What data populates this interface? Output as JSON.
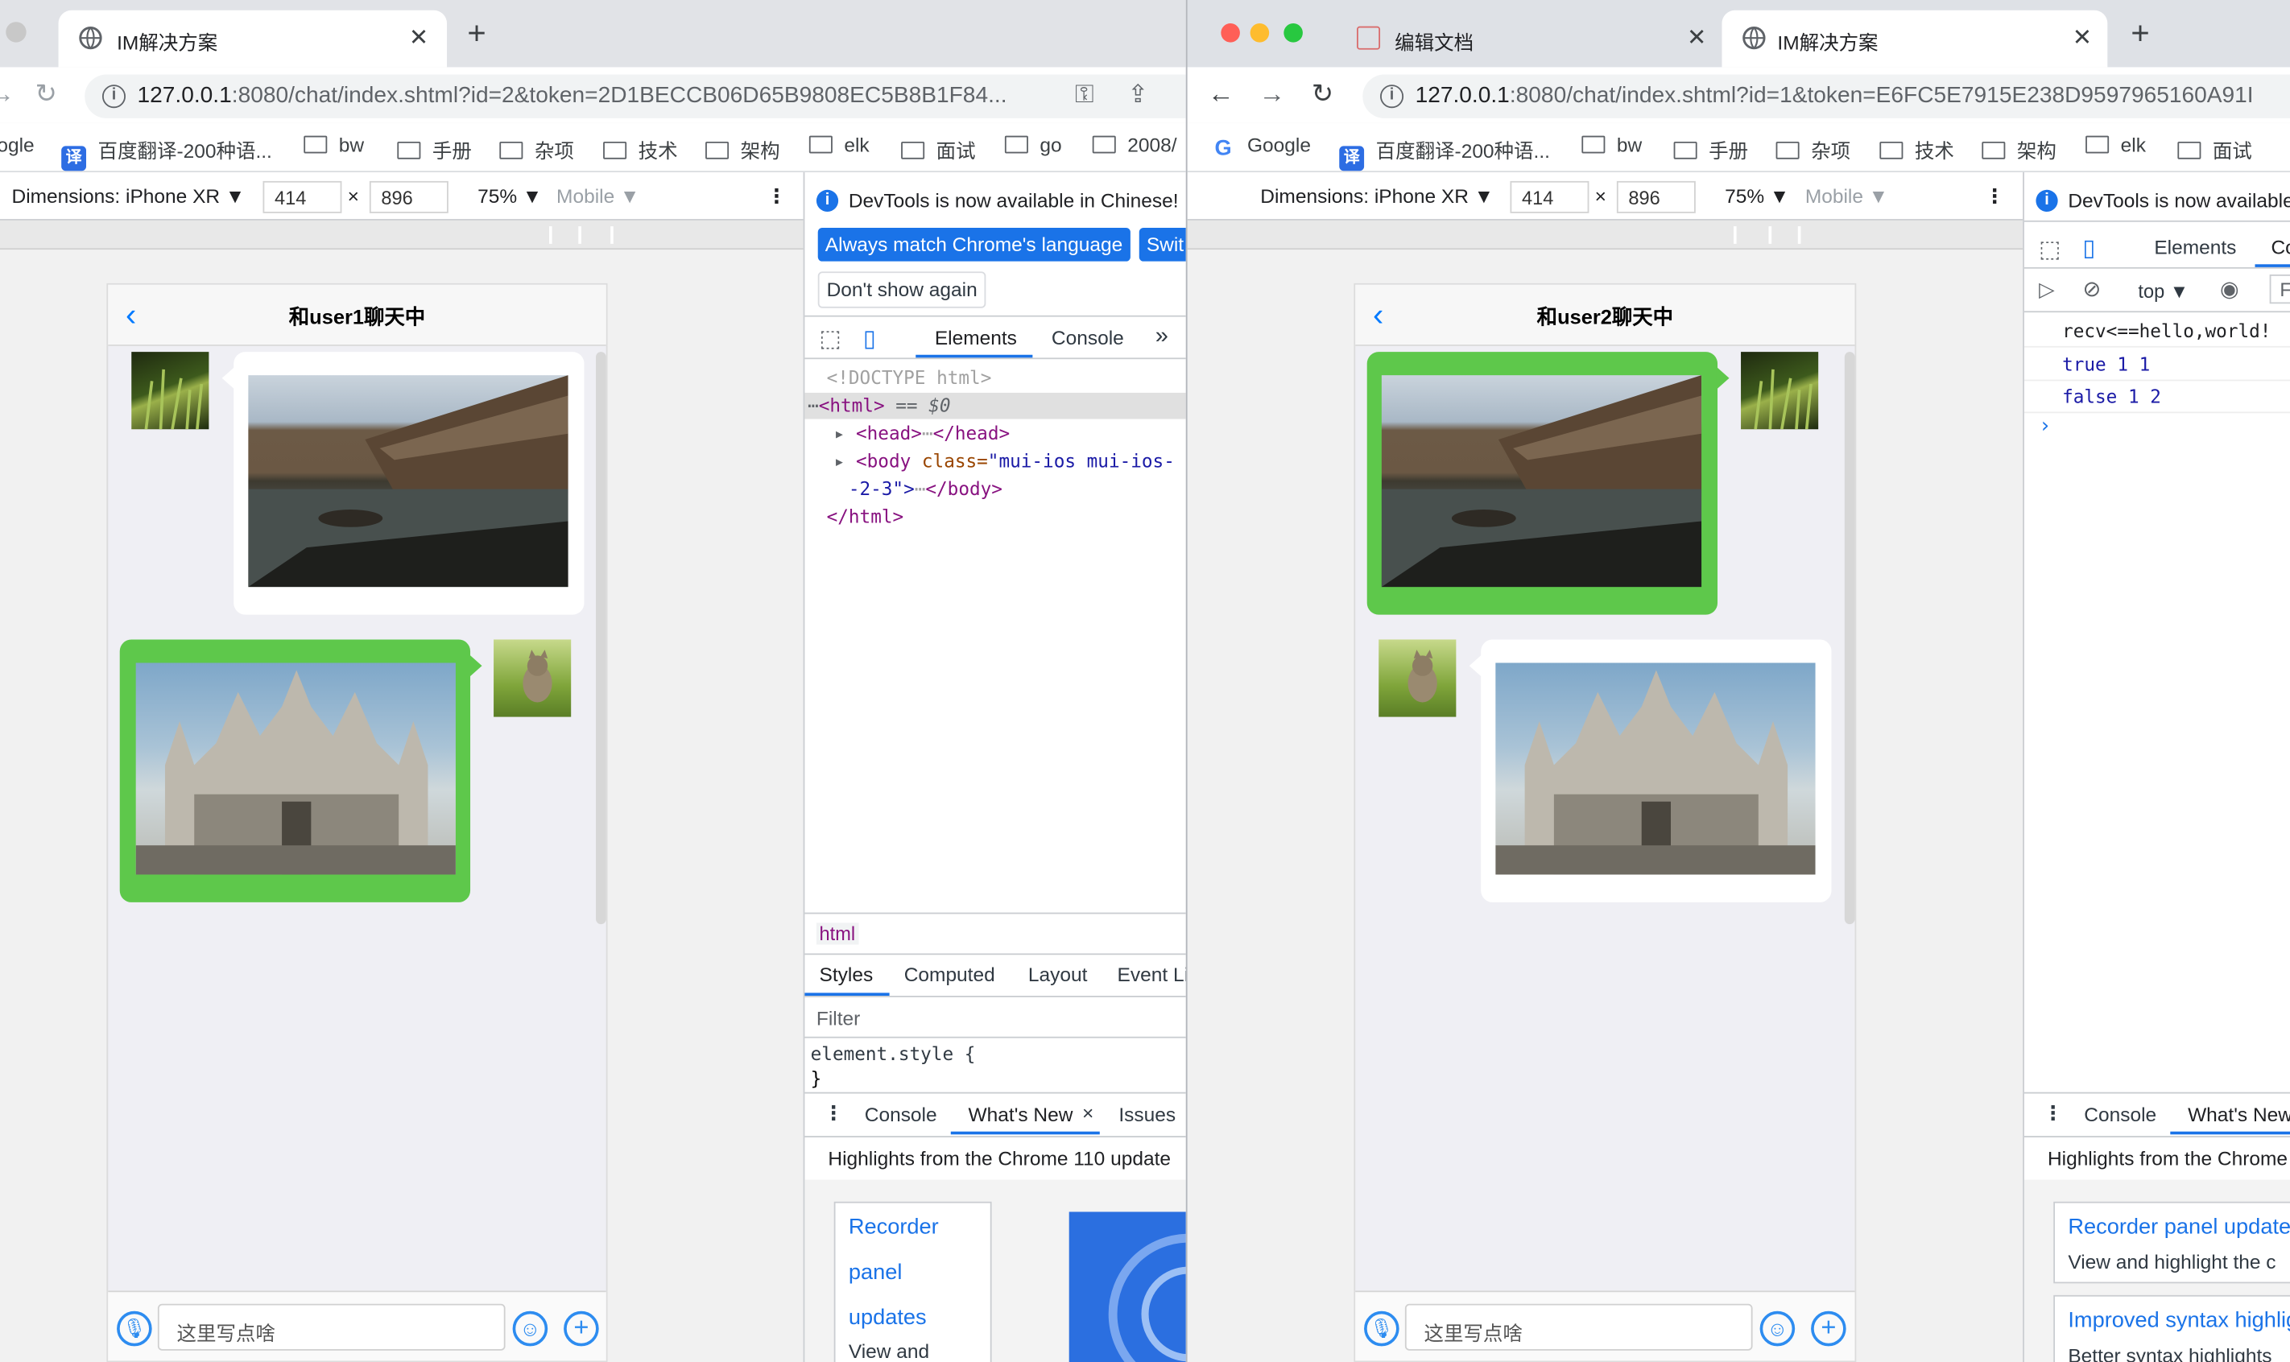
{
  "left": {
    "tab_title": "IM解决方案",
    "url_host": "127.0.0.1",
    "url_rest": ":8080/chat/index.shtml?id=2&token=2D1BECCB06D65B9808EC5B8B1F84...",
    "bookmarks": [
      "ogle",
      "百度翻译-200种语...",
      "bw",
      "手册",
      "杂项",
      "技术",
      "架构",
      "elk",
      "面试",
      "go",
      "2008/"
    ],
    "device": "Dimensions: iPhone XR ▼",
    "width": "414",
    "height": "896",
    "zoom": "75% ▼",
    "mode": "Mobile ▼",
    "chat_title": "和user1聊天中",
    "input_placeholder": "这里写点啥",
    "devtools": {
      "info": "DevTools is now available in Chinese!",
      "btn_match": "Always match Chrome's language",
      "btn_switch": "Swit",
      "btn_dont": "Don't show again",
      "tabs": [
        "Elements",
        "Console"
      ],
      "more": "»",
      "doctype": "<!DOCTYPE html>",
      "html_open": "<html>",
      "html_eq": "== $0",
      "head_open": "<head>",
      "head_close": "</head>",
      "body_open": "<body ",
      "body_attr": "class=",
      "body_val1": "\"mui-ios mui-ios-",
      "body_val2": "-2-3\">",
      "body_close": "</body>",
      "html_close": "</html>",
      "breadcrumb": "html",
      "style_tabs": [
        "Styles",
        "Computed",
        "Layout",
        "Event Li"
      ],
      "filter": "Filter",
      "element_style": "element.style {",
      "brace_close": "}",
      "drawer_tabs": [
        "Console",
        "What's New",
        "Issues"
      ],
      "drawer_close": "×",
      "highlights": "Highlights from the Chrome 110 update",
      "card_lines": [
        "Recorder",
        "panel",
        "updates",
        "View and"
      ]
    }
  },
  "right": {
    "tab1_title": "编辑文档",
    "tab2_title": "IM解决方案",
    "url_host": "127.0.0.1",
    "url_rest": ":8080/chat/index.shtml?id=1&token=E6FC5E7915E238D9597965160A91I",
    "bookmarks": [
      "Google",
      "百度翻译-200种语...",
      "bw",
      "手册",
      "杂项",
      "技术",
      "架构",
      "elk",
      "面试"
    ],
    "device": "Dimensions: iPhone XR ▼",
    "width": "414",
    "height": "896",
    "zoom": "75% ▼",
    "mode": "Mobile ▼",
    "chat_title": "和user2聊天中",
    "input_placeholder": "这里写点啥",
    "devtools": {
      "info": "DevTools is now available",
      "tabs": [
        "Elements",
        "Co"
      ],
      "context": "top ▼",
      "filter_stub": "F",
      "console_lines": [
        "recv<==hello,world!",
        "true 1 1",
        "false 1 2"
      ],
      "prompt": "›",
      "drawer_tabs": [
        "Console",
        "What's New"
      ],
      "highlights": "Highlights from the Chrome",
      "card1_title": "Recorder panel update",
      "card1_text": "View and highlight the c",
      "card2_title": "Improved syntax highlig",
      "card2_text": "Better syntax highlights"
    }
  },
  "colors": {
    "bubble_green": "#5ec84b",
    "link_blue": "#1a73e8",
    "mui_blue": "#007aff"
  }
}
